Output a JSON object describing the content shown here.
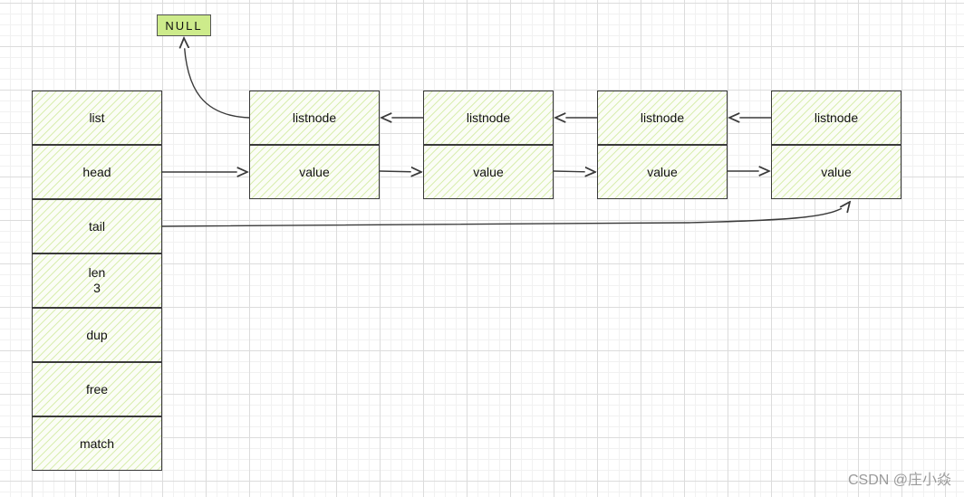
{
  "null_label": "NULL",
  "list_struct": {
    "fields": [
      "list",
      "head",
      "tail",
      "len\n3",
      "dup",
      "free",
      "match"
    ]
  },
  "nodes": [
    {
      "top": "listnode",
      "bottom": "value"
    },
    {
      "top": "listnode",
      "bottom": "value"
    },
    {
      "top": "listnode",
      "bottom": "value"
    },
    {
      "top": "listnode",
      "bottom": "value"
    }
  ],
  "colors": {
    "stroke": "#3a3a3a",
    "null_fill": "#cdeb8b",
    "hatch": "#bee178"
  },
  "watermark": "CSDN @庄小焱"
}
